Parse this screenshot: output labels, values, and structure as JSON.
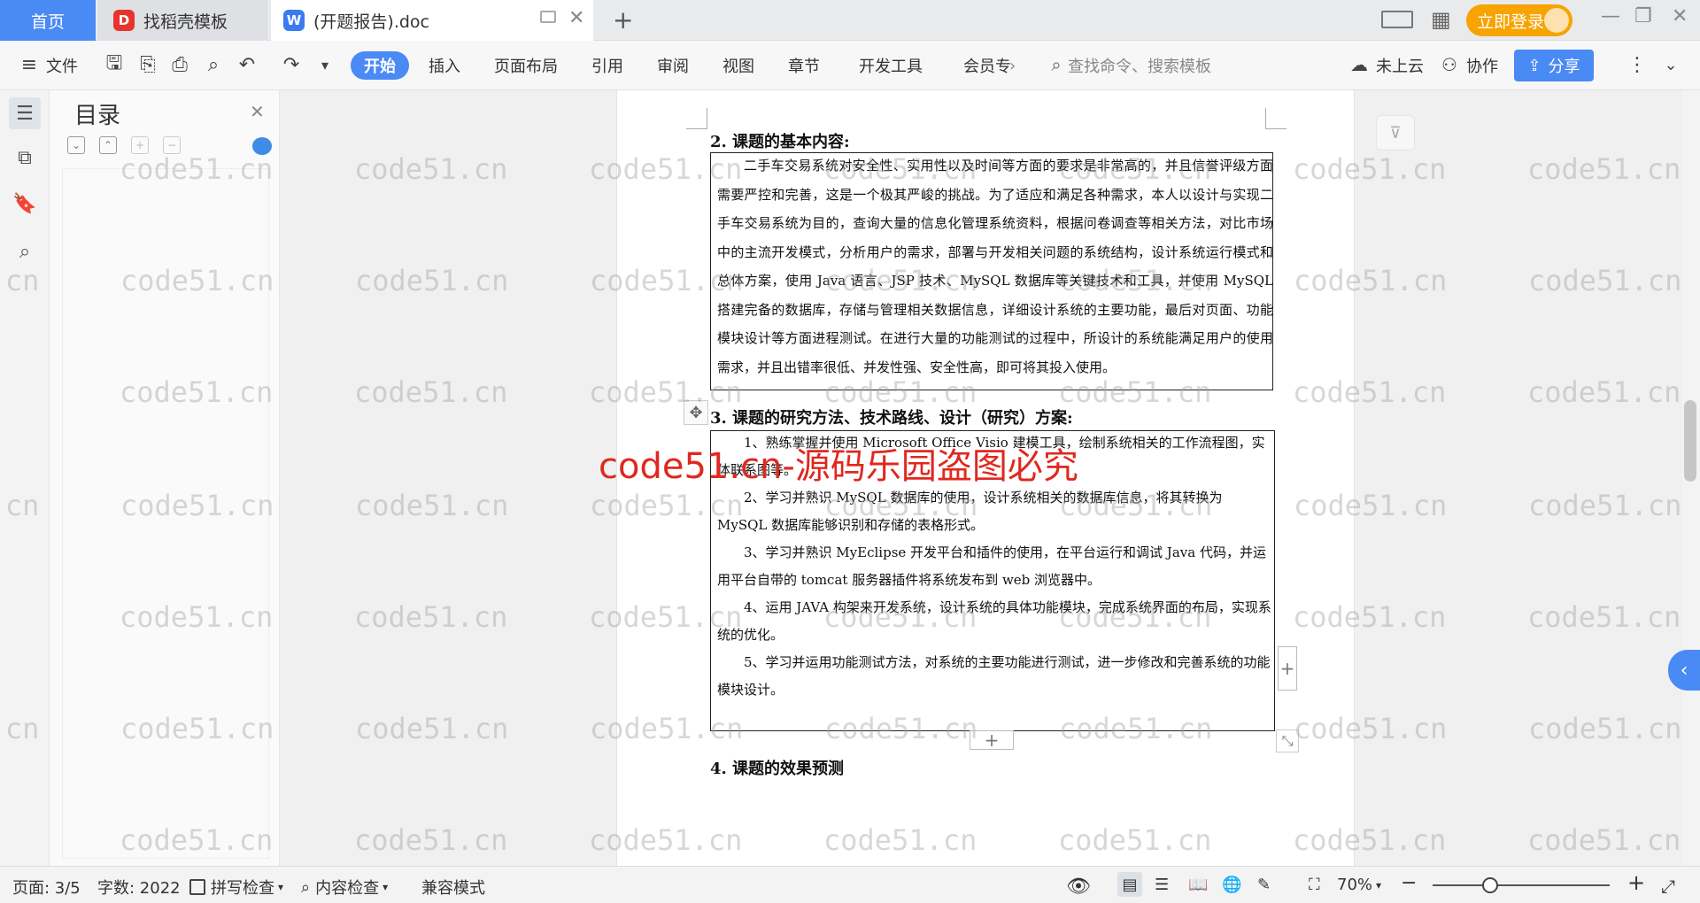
{
  "tabs": {
    "home": "首页",
    "template": "找稻壳模板",
    "document": "(开题报告).doc",
    "login": "立即登录"
  },
  "toolbar": {
    "file": "文件",
    "menus": [
      "开始",
      "插入",
      "页面布局",
      "引用",
      "审阅",
      "视图",
      "章节",
      "开发工具",
      "会员专"
    ],
    "search_placeholder": "查找命令、搜索模板",
    "cloud": "未上云",
    "collab": "协作",
    "share": "分享"
  },
  "toc": {
    "title": "目录"
  },
  "document": {
    "sec2_title": "2.  课题的基本内容:",
    "sec2_body": "二手车交易系统对安全性、实用性以及时间等方面的要求是非常高的，并且信誉评级方面需要严控和完善，这是一个极其严峻的挑战。为了适应和满足各种需求，本人以设计与实现二手车交易系统为目的，查询大量的信息化管理系统资料，根据问卷调查等相关方法，对比市场中的主流开发模式，分析用户的需求，部署与开发相关问题的系统结构，设计系统运行模式和总体方案，使用 Java 语言、JSP 技术、MySQL 数据库等关键技术和工具，并使用 MySQL 搭建完备的数据库，存储与管理相关数据信息，详细设计系统的主要功能，最后对页面、功能模块设计等方面进程测试。在进行大量的功能测试的过程中，所设计的系统能满足用户的使用需求，并且出错率很低、并发性强、安全性高，即可将其投入使用。",
    "sec3_title": "3.  课题的研究方法、技术路线、设计（研究）方案:",
    "sec3_items": [
      "1、熟练掌握并使用 Microsoft Office Visio 建模工具，绘制系统相关的工作流程图，实体联系图等。",
      "2、学习并熟识 MySQL 数据库的使用，设计系统相关的数据库信息，将其转换为 MySQL 数据库能够识别和存储的表格形式。",
      "3、学习并熟识 MyEclipse 开发平台和插件的使用，在平台运行和调试 Java 代码，并运用平台自带的 tomcat 服务器插件将系统发布到 web 浏览器中。",
      "4、运用 JAVA 构架来开发系统，设计系统的具体功能模块，完成系统界面的布局，实现系统的优化。",
      "5、学习并运用功能测试方法，对系统的主要功能进行测试，进一步修改和完善系统的功能模块设计。"
    ],
    "sec4_title": "4.  课题的效果预测",
    "overlay": "code51.cn-源码乐园盗图必究",
    "watermark": "code51.cn"
  },
  "status": {
    "page": "页面: 3/5",
    "words": "字数: 2022",
    "spell": "拼写检查",
    "content_check": "内容检查",
    "compat": "兼容模式",
    "zoom": "70%"
  }
}
